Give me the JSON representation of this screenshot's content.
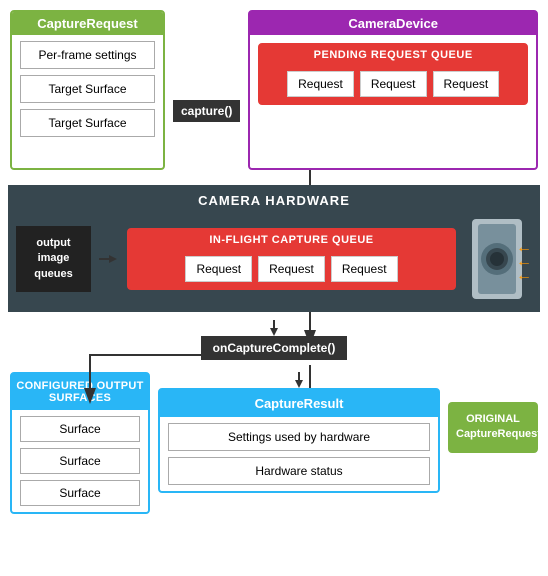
{
  "captureRequest": {
    "title": "CaptureRequest",
    "items": [
      {
        "label": "Per-frame settings"
      },
      {
        "label": "Target Surface"
      },
      {
        "label": "Target Surface"
      }
    ]
  },
  "captureLabel": "capture()",
  "cameraDevice": {
    "title": "CameraDevice",
    "pendingQueue": {
      "title": "PENDING REQUEST QUEUE",
      "requests": [
        "Request",
        "Request",
        "Request"
      ]
    }
  },
  "hardwareSection": {
    "title": "CAMERA HARDWARE",
    "outputQueuesLabel": "output image\nqueues",
    "inflightQueue": {
      "title": "IN-FLIGHT CAPTURE QUEUE",
      "requests": [
        "Request",
        "Request",
        "Request"
      ]
    }
  },
  "onCaptureComplete": "onCaptureComplete()",
  "configuredSurfaces": {
    "title": "CONFIGURED OUTPUT\nSURFACES",
    "surfaces": [
      "Surface",
      "Surface",
      "Surface"
    ]
  },
  "captureResult": {
    "title": "CaptureResult",
    "items": [
      "Settings used by hardware",
      "Hardware status"
    ]
  },
  "originalCaptureRequest": "ORIGINAL\nCaptureRequest",
  "colors": {
    "green": "#7cb342",
    "purple": "#9c27b0",
    "red": "#e53935",
    "darkGray": "#37474f",
    "black": "#333",
    "lightBlue": "#29b6f6",
    "orange": "#ff9800"
  }
}
